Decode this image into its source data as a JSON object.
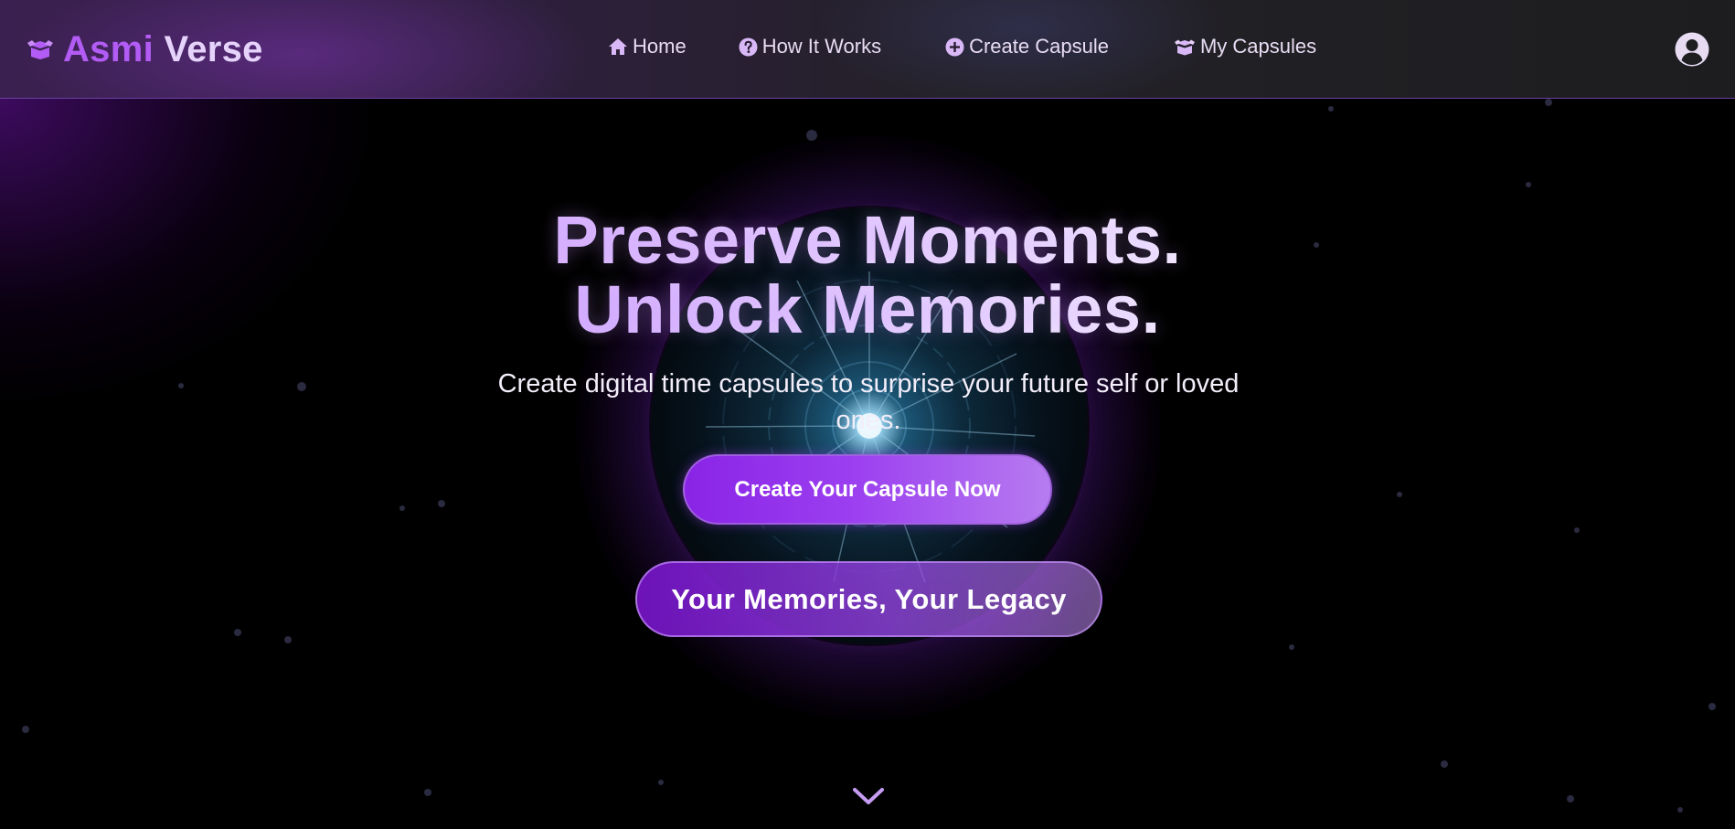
{
  "app": {
    "brand_part1": "Asmi",
    "brand_part2": "Verse",
    "brand_icon": "box-open-icon"
  },
  "nav": {
    "items": [
      {
        "label": "Home",
        "icon": "home-icon"
      },
      {
        "label": "How It Works",
        "icon": "question-circle-icon"
      },
      {
        "label": "Create Capsule",
        "icon": "plus-circle-icon"
      },
      {
        "label": "My Capsules",
        "icon": "box-open-icon"
      }
    ],
    "profile_icon": "user-circle-icon"
  },
  "hero": {
    "title_line1": "Preserve Moments.",
    "title_line2": "Unlock Memories.",
    "subtitle": "Create digital time capsules to surprise your future self or loved ones.",
    "cta_label": "Create Your Capsule Now",
    "tagline": "Your Memories, Your Legacy",
    "scroll_icon": "chevron-down-icon"
  },
  "colors": {
    "accent": "#9b3ef0",
    "brand_primary": "#b25cf5",
    "brand_light": "#e6d3fb",
    "background": "#000000",
    "nav_border": "#6d3fa6"
  }
}
